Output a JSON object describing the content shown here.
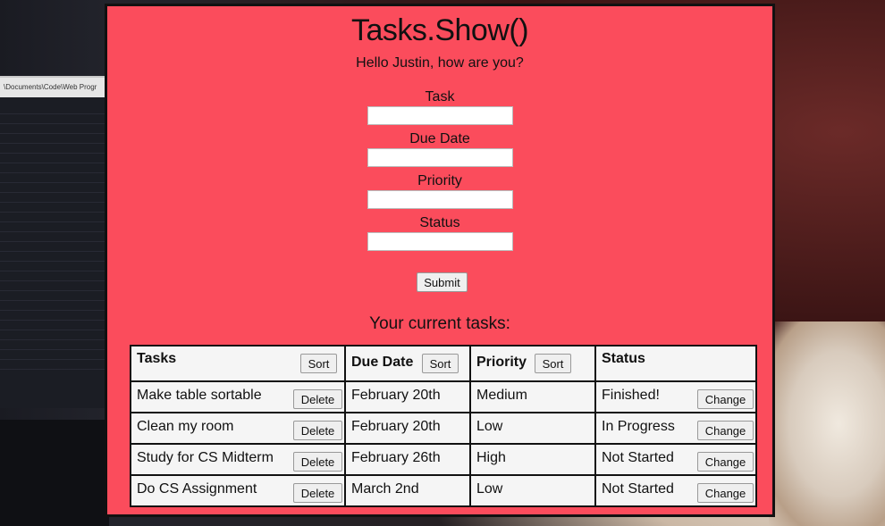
{
  "background": {
    "editor_path": "\\Documents\\Code\\Web Progr"
  },
  "app": {
    "title": "Tasks.Show()",
    "greeting": "Hello Justin, how are you?",
    "colors": {
      "panel_bg": "#fb4c5c",
      "border": "#111111",
      "table_bg": "#f5f5f5"
    }
  },
  "form": {
    "fields": [
      {
        "label": "Task",
        "value": "",
        "placeholder": ""
      },
      {
        "label": "Due Date",
        "value": "",
        "placeholder": ""
      },
      {
        "label": "Priority",
        "value": "",
        "placeholder": ""
      },
      {
        "label": "Status",
        "value": "",
        "placeholder": ""
      }
    ],
    "submit_label": "Submit"
  },
  "tasks_section": {
    "heading": "Your current tasks:",
    "columns": [
      {
        "label": "Tasks",
        "sort_label": "Sort"
      },
      {
        "label": "Due Date",
        "sort_label": "Sort"
      },
      {
        "label": "Priority",
        "sort_label": "Sort"
      },
      {
        "label": "Status"
      }
    ],
    "delete_label": "Delete",
    "change_label": "Change",
    "rows": [
      {
        "task": "Make table sortable",
        "due": "February 20th",
        "priority": "Medium",
        "status": "Finished!"
      },
      {
        "task": "Clean my room",
        "due": "February 20th",
        "priority": "Low",
        "status": "In Progress"
      },
      {
        "task": "Study for CS Midterm",
        "due": "February 26th",
        "priority": "High",
        "status": "Not Started"
      },
      {
        "task": "Do CS Assignment",
        "due": "March 2nd",
        "priority": "Low",
        "status": "Not Started"
      }
    ]
  }
}
